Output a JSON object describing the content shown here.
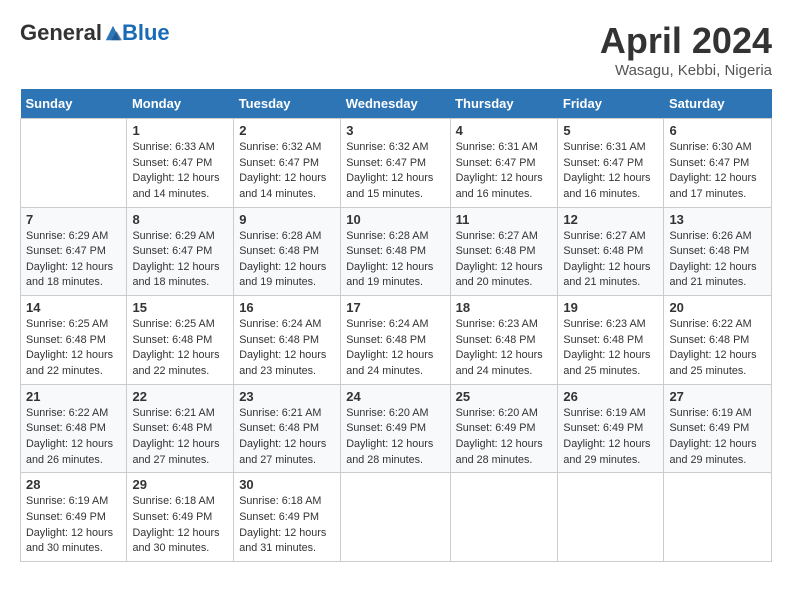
{
  "header": {
    "logo_general": "General",
    "logo_blue": "Blue",
    "title": "April 2024",
    "subtitle": "Wasagu, Kebbi, Nigeria"
  },
  "weekdays": [
    "Sunday",
    "Monday",
    "Tuesday",
    "Wednesday",
    "Thursday",
    "Friday",
    "Saturday"
  ],
  "weeks": [
    [
      {
        "num": "",
        "info": ""
      },
      {
        "num": "1",
        "info": "Sunrise: 6:33 AM\nSunset: 6:47 PM\nDaylight: 12 hours\nand 14 minutes."
      },
      {
        "num": "2",
        "info": "Sunrise: 6:32 AM\nSunset: 6:47 PM\nDaylight: 12 hours\nand 14 minutes."
      },
      {
        "num": "3",
        "info": "Sunrise: 6:32 AM\nSunset: 6:47 PM\nDaylight: 12 hours\nand 15 minutes."
      },
      {
        "num": "4",
        "info": "Sunrise: 6:31 AM\nSunset: 6:47 PM\nDaylight: 12 hours\nand 16 minutes."
      },
      {
        "num": "5",
        "info": "Sunrise: 6:31 AM\nSunset: 6:47 PM\nDaylight: 12 hours\nand 16 minutes."
      },
      {
        "num": "6",
        "info": "Sunrise: 6:30 AM\nSunset: 6:47 PM\nDaylight: 12 hours\nand 17 minutes."
      }
    ],
    [
      {
        "num": "7",
        "info": "Sunrise: 6:29 AM\nSunset: 6:47 PM\nDaylight: 12 hours\nand 18 minutes."
      },
      {
        "num": "8",
        "info": "Sunrise: 6:29 AM\nSunset: 6:47 PM\nDaylight: 12 hours\nand 18 minutes."
      },
      {
        "num": "9",
        "info": "Sunrise: 6:28 AM\nSunset: 6:48 PM\nDaylight: 12 hours\nand 19 minutes."
      },
      {
        "num": "10",
        "info": "Sunrise: 6:28 AM\nSunset: 6:48 PM\nDaylight: 12 hours\nand 19 minutes."
      },
      {
        "num": "11",
        "info": "Sunrise: 6:27 AM\nSunset: 6:48 PM\nDaylight: 12 hours\nand 20 minutes."
      },
      {
        "num": "12",
        "info": "Sunrise: 6:27 AM\nSunset: 6:48 PM\nDaylight: 12 hours\nand 21 minutes."
      },
      {
        "num": "13",
        "info": "Sunrise: 6:26 AM\nSunset: 6:48 PM\nDaylight: 12 hours\nand 21 minutes."
      }
    ],
    [
      {
        "num": "14",
        "info": "Sunrise: 6:25 AM\nSunset: 6:48 PM\nDaylight: 12 hours\nand 22 minutes."
      },
      {
        "num": "15",
        "info": "Sunrise: 6:25 AM\nSunset: 6:48 PM\nDaylight: 12 hours\nand 22 minutes."
      },
      {
        "num": "16",
        "info": "Sunrise: 6:24 AM\nSunset: 6:48 PM\nDaylight: 12 hours\nand 23 minutes."
      },
      {
        "num": "17",
        "info": "Sunrise: 6:24 AM\nSunset: 6:48 PM\nDaylight: 12 hours\nand 24 minutes."
      },
      {
        "num": "18",
        "info": "Sunrise: 6:23 AM\nSunset: 6:48 PM\nDaylight: 12 hours\nand 24 minutes."
      },
      {
        "num": "19",
        "info": "Sunrise: 6:23 AM\nSunset: 6:48 PM\nDaylight: 12 hours\nand 25 minutes."
      },
      {
        "num": "20",
        "info": "Sunrise: 6:22 AM\nSunset: 6:48 PM\nDaylight: 12 hours\nand 25 minutes."
      }
    ],
    [
      {
        "num": "21",
        "info": "Sunrise: 6:22 AM\nSunset: 6:48 PM\nDaylight: 12 hours\nand 26 minutes."
      },
      {
        "num": "22",
        "info": "Sunrise: 6:21 AM\nSunset: 6:48 PM\nDaylight: 12 hours\nand 27 minutes."
      },
      {
        "num": "23",
        "info": "Sunrise: 6:21 AM\nSunset: 6:48 PM\nDaylight: 12 hours\nand 27 minutes."
      },
      {
        "num": "24",
        "info": "Sunrise: 6:20 AM\nSunset: 6:49 PM\nDaylight: 12 hours\nand 28 minutes."
      },
      {
        "num": "25",
        "info": "Sunrise: 6:20 AM\nSunset: 6:49 PM\nDaylight: 12 hours\nand 28 minutes."
      },
      {
        "num": "26",
        "info": "Sunrise: 6:19 AM\nSunset: 6:49 PM\nDaylight: 12 hours\nand 29 minutes."
      },
      {
        "num": "27",
        "info": "Sunrise: 6:19 AM\nSunset: 6:49 PM\nDaylight: 12 hours\nand 29 minutes."
      }
    ],
    [
      {
        "num": "28",
        "info": "Sunrise: 6:19 AM\nSunset: 6:49 PM\nDaylight: 12 hours\nand 30 minutes."
      },
      {
        "num": "29",
        "info": "Sunrise: 6:18 AM\nSunset: 6:49 PM\nDaylight: 12 hours\nand 30 minutes."
      },
      {
        "num": "30",
        "info": "Sunrise: 6:18 AM\nSunset: 6:49 PM\nDaylight: 12 hours\nand 31 minutes."
      },
      {
        "num": "",
        "info": ""
      },
      {
        "num": "",
        "info": ""
      },
      {
        "num": "",
        "info": ""
      },
      {
        "num": "",
        "info": ""
      }
    ]
  ]
}
